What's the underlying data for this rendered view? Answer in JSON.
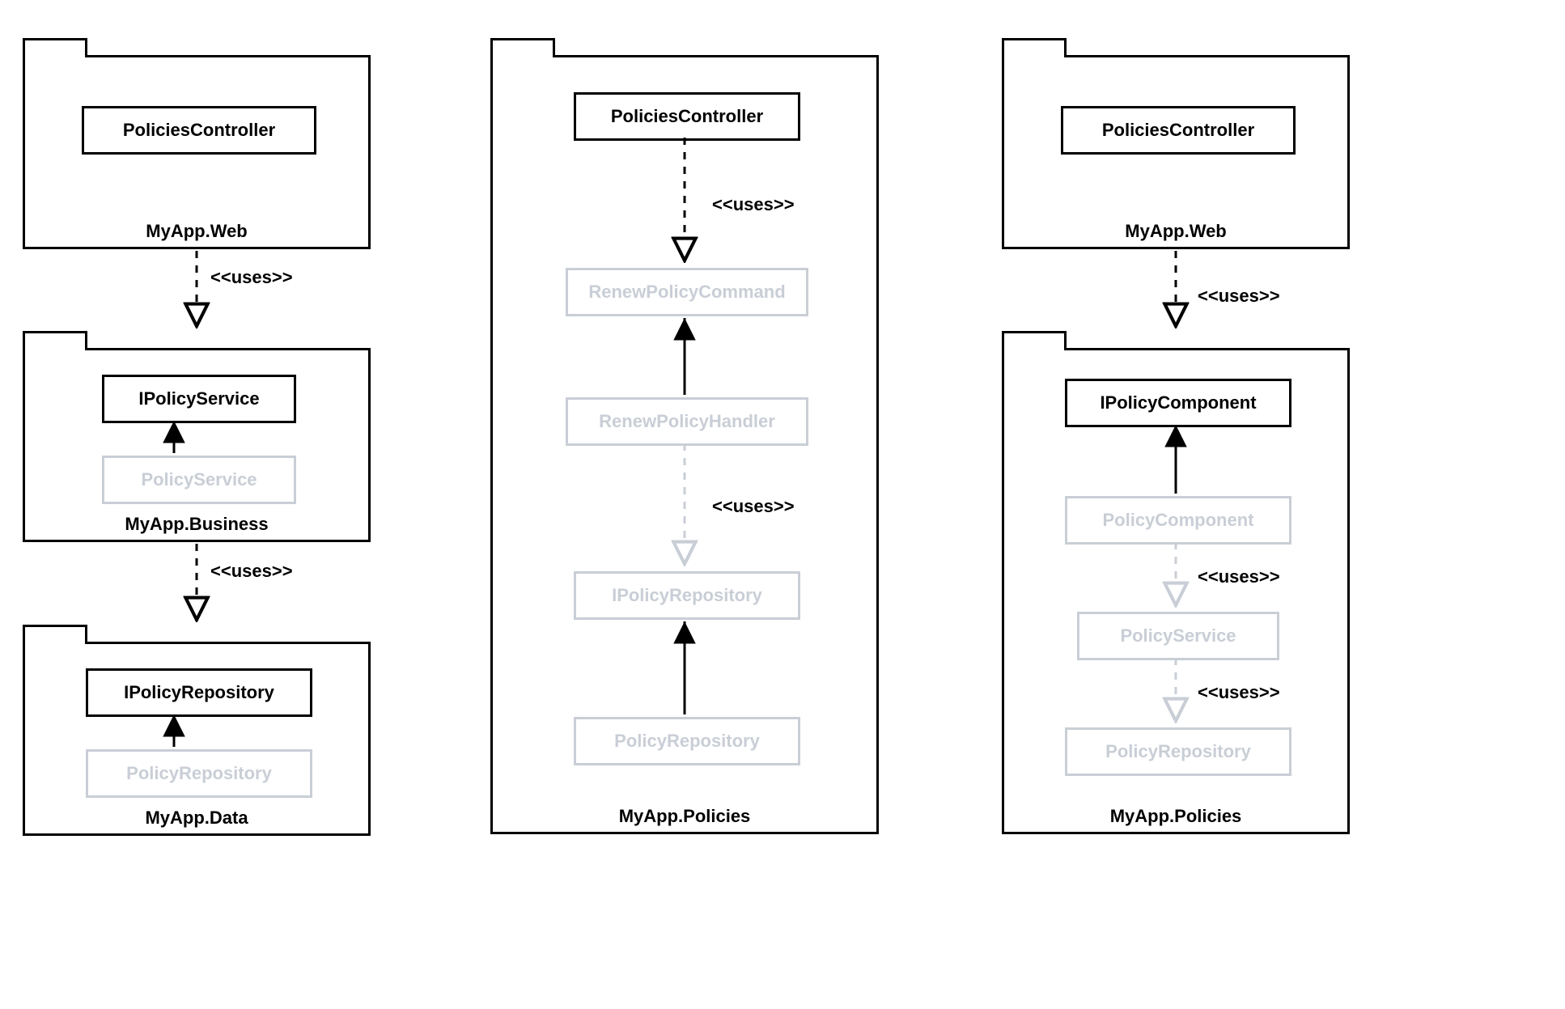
{
  "stereotypes": {
    "uses": "<<uses>>"
  },
  "col1": {
    "pkg_web": {
      "label": "MyApp.Web",
      "node": "PoliciesController"
    },
    "pkg_business": {
      "label": "MyApp.Business",
      "iface": "IPolicyService",
      "impl": "PolicyService"
    },
    "pkg_data": {
      "label": "MyApp.Data",
      "iface": "IPolicyRepository",
      "impl": "PolicyRepository"
    }
  },
  "col2": {
    "pkg": {
      "label": "MyApp.Policies"
    },
    "nodes": {
      "controller": "PoliciesController",
      "command": "RenewPolicyCommand",
      "handler": "RenewPolicyHandler",
      "irepo": "IPolicyRepository",
      "repo": "PolicyRepository"
    }
  },
  "col3": {
    "pkg_web": {
      "label": "MyApp.Web",
      "node": "PoliciesController"
    },
    "pkg_policies": {
      "label": "MyApp.Policies",
      "iface": "IPolicyComponent",
      "comp": "PolicyComponent",
      "service": "PolicyService",
      "repo": "PolicyRepository"
    }
  }
}
